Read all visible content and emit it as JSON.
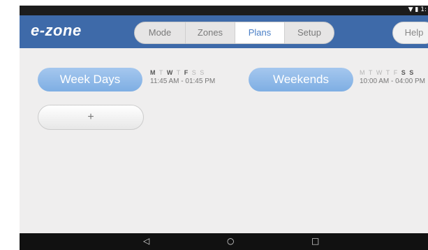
{
  "status_bar": {
    "icons": [
      "wifi-icon",
      "battery-icon"
    ],
    "time": "1:"
  },
  "app": {
    "logo": "e-zone"
  },
  "tabs": [
    {
      "label": "Mode",
      "active": false
    },
    {
      "label": "Zones",
      "active": false
    },
    {
      "label": "Plans",
      "active": true
    },
    {
      "label": "Setup",
      "active": false
    }
  ],
  "help_label": "Help",
  "plans": [
    {
      "name": "Week Days",
      "days": [
        {
          "letter": "M",
          "on": true
        },
        {
          "letter": "T",
          "on": false
        },
        {
          "letter": "W",
          "on": true
        },
        {
          "letter": "T",
          "on": false
        },
        {
          "letter": "F",
          "on": true
        },
        {
          "letter": "S",
          "on": false
        },
        {
          "letter": "S",
          "on": false
        }
      ],
      "time": "11:45 AM - 01:45 PM"
    },
    {
      "name": "Weekends",
      "days": [
        {
          "letter": "M",
          "on": false
        },
        {
          "letter": "T",
          "on": false
        },
        {
          "letter": "W",
          "on": false
        },
        {
          "letter": "T",
          "on": false
        },
        {
          "letter": "F",
          "on": false
        },
        {
          "letter": "S",
          "on": true
        },
        {
          "letter": "S",
          "on": true
        }
      ],
      "time": "10:00 AM - 04:00 PM"
    }
  ],
  "add_label": "+",
  "nav": {
    "back": "◁",
    "home": "○",
    "recents": "□"
  },
  "colors": {
    "app_bar": "#3e6aa9",
    "plan_button": "#86b3e6",
    "active_tab_text": "#4a7fc7"
  }
}
